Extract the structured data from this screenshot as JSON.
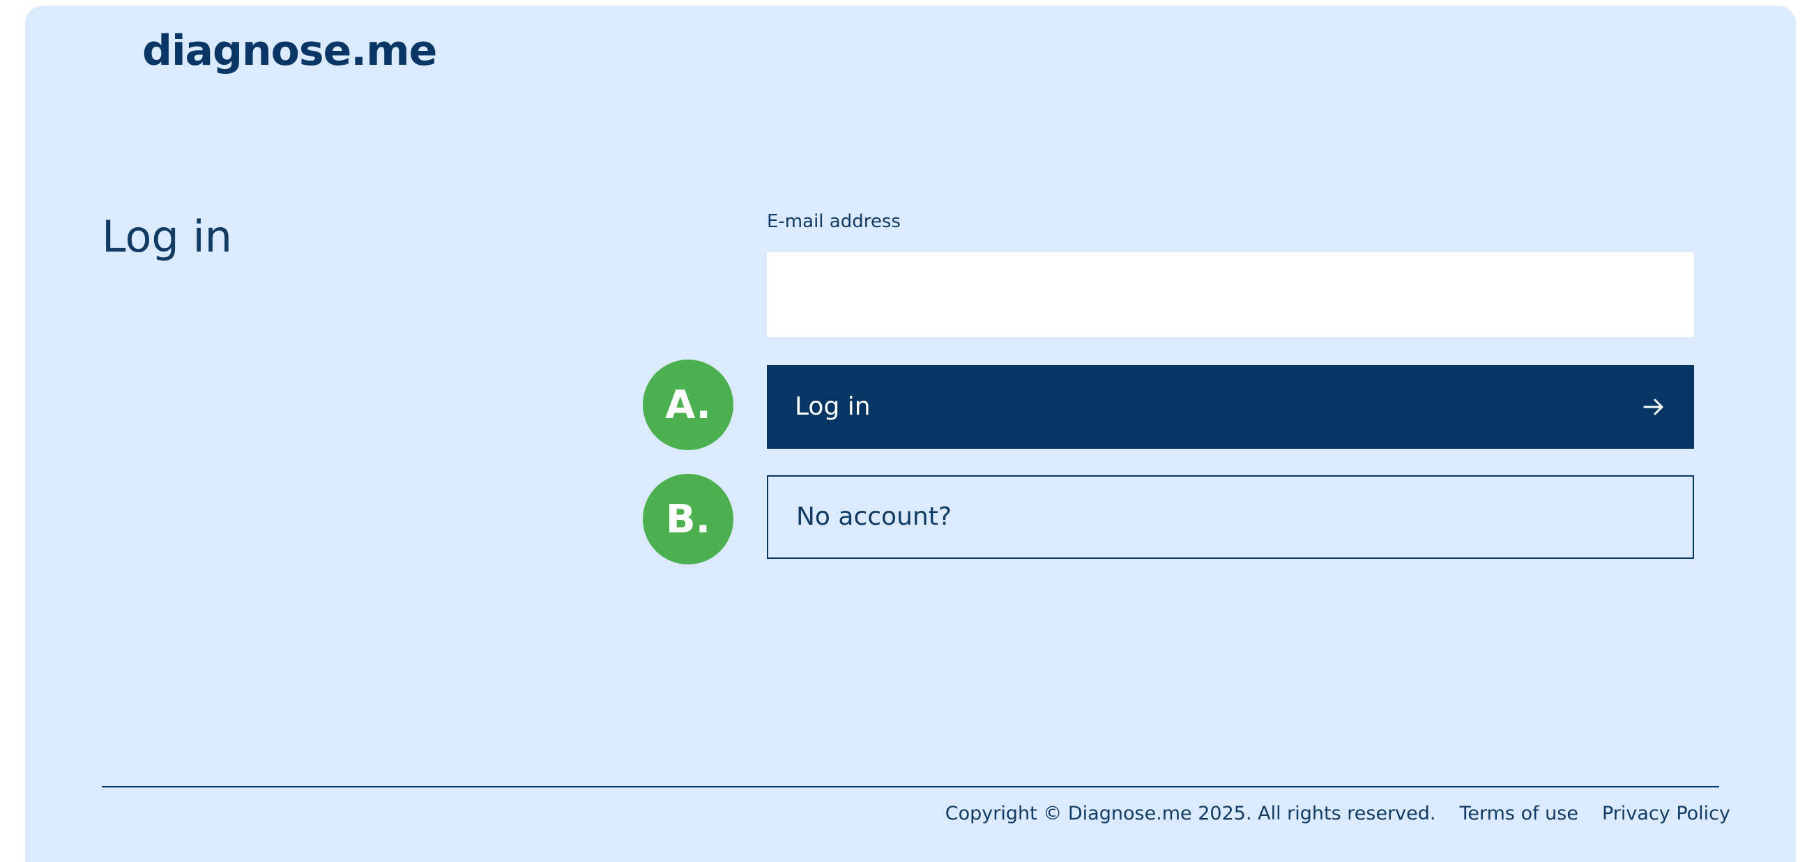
{
  "brand": {
    "logo_text": "diagnose.me"
  },
  "page": {
    "title": "Log in"
  },
  "form": {
    "email_label": "E-mail address",
    "email_value": "",
    "email_placeholder": ""
  },
  "buttons": {
    "login_label": "Log in",
    "login_icon": "arrow-right-icon",
    "no_account_label": "No account?"
  },
  "markers": {
    "a": "A.",
    "b": "B."
  },
  "footer": {
    "copyright": "Copyright © Diagnose.me 2025. All rights reserved.",
    "terms": "Terms of use",
    "privacy": "Privacy Policy"
  },
  "colors": {
    "background": "#dbeafc",
    "primary": "#073665",
    "text": "#123b63",
    "marker": "#4caf50",
    "input_bg": "#ffffff"
  }
}
